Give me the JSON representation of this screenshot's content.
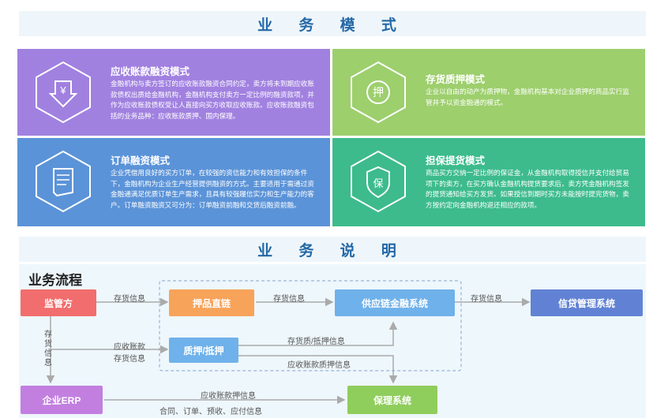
{
  "banners": {
    "top": "业 务 模 式",
    "middle": "业 务 说 明"
  },
  "cards": [
    {
      "title": "应收账款融资模式",
      "icon": "yen-down-icon",
      "desc": "金融机构与卖方签订的应收账款融资合同约定，卖方将未到期应收账款债权出质给金融机构，金融机构支付卖方一定比例的融资款项，并作为应收账款债权受让人直接向买方收取应收账款。应收账款融资包括的业务品种：应收账款质押、国内保理。"
    },
    {
      "title": "存货质押模式",
      "icon": "pledge-seal-icon",
      "desc": "企业以自由的动产为质押物，金融机构基本对企业质押的商品实行监管并予以资金融通的模式。"
    },
    {
      "title": "订单融资模式",
      "icon": "order-document-icon",
      "desc": "企业凭借用良好的买方订单，在较强的资信能力和有效担保的条件下，金融机构为企业生产经营提供融资的方式。主要适用于需通过资金融通满足优质订单生产需求，且具有较强履信实力和生产能力的客户。订单融资融资又可分为：订单融资前融和交货后融资前融。"
    },
    {
      "title": "担保提货模式",
      "icon": "guarantee-shield-icon",
      "desc": "商品买方交纳一定比例的保证金，从金融机构取得授信并支付给贸易项下的卖方，在买方确认金融机构提货要求后，卖方凭金融机构签发的提货通知给买方发货。如果授信到期时买方未能按时提完货物，卖方按约定向金融机构退还相应的款项。"
    }
  ],
  "flow": {
    "title": "业务流程",
    "boxes": {
      "regulator": "监管方",
      "direct_link": "押品直链",
      "scf_system": "供应链金融系统",
      "credit_system": "信贷管理系统",
      "pledge": "质押/抵押",
      "erp": "企业ERP",
      "factoring": "保理系统"
    },
    "labels": {
      "inv_info_1": "存货信息",
      "inv_info_2": "存货信息",
      "inv_info_3": "存货信息",
      "inv_info_vertical": "存货信息",
      "receivable": "应收账款",
      "inv_info_4": "存货信息",
      "pledge_info": "存货质/抵押信息",
      "rec_pledge_info": "应收账款质押信息",
      "rec_pledge_info_2": "应收账款押信息",
      "contract": "合同、订单、预收、应付信息"
    }
  },
  "colors": {
    "card1": "#a181e0",
    "card2": "#9dcf6d",
    "card3": "#5b93d8",
    "card4": "#3dbb8c",
    "box_red": "#f26d6d",
    "box_orange": "#f7a35a",
    "box_blue": "#6fb1ea",
    "box_navy": "#6182d4",
    "box_purple": "#c27fe0",
    "box_green": "#8fcd5d"
  }
}
